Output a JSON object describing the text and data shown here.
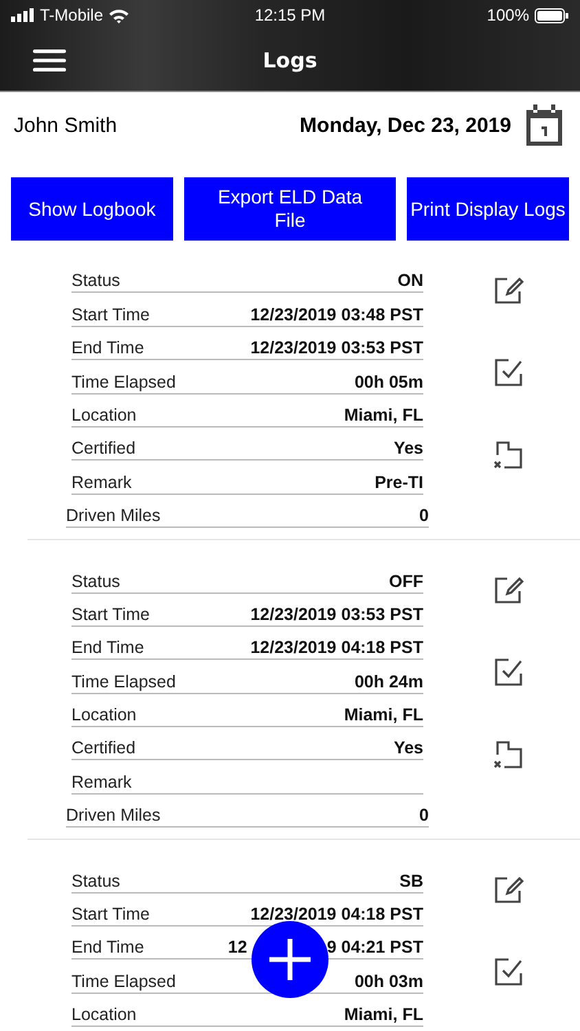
{
  "status_bar": {
    "carrier": "T-Mobile",
    "time": "12:15 PM",
    "battery": "100%"
  },
  "nav": {
    "title": "Logs"
  },
  "header": {
    "driver": "John Smith",
    "date": "Monday, Dec 23, 2019"
  },
  "buttons": [
    {
      "label": "Show Logbook"
    },
    {
      "label": "Export ELD Data File"
    },
    {
      "label": "Print Display Logs"
    }
  ],
  "logs": [
    {
      "rows": [
        {
          "label": "Status",
          "value": "ON"
        },
        {
          "label": "Start Time",
          "value": "12/23/2019 03:48 PST"
        },
        {
          "label": "End Time",
          "value": "12/23/2019 03:53 PST"
        },
        {
          "label": "Time Elapsed",
          "value": "00h 05m"
        },
        {
          "label": "Location",
          "value": "Miami, FL"
        },
        {
          "label": "Certified",
          "value": "Yes"
        },
        {
          "label": "Remark",
          "value": "Pre-TI"
        },
        {
          "label": "Driven Miles",
          "value": "0"
        }
      ],
      "actions": [
        {
          "kind": "edit"
        },
        {
          "kind": "certify"
        },
        {
          "kind": "unassign"
        }
      ]
    },
    {
      "rows": [
        {
          "label": "Status",
          "value": "OFF"
        },
        {
          "label": "Start Time",
          "value": "12/23/2019 03:53 PST"
        },
        {
          "label": "End Time",
          "value": "12/23/2019 04:18 PST"
        },
        {
          "label": "Time Elapsed",
          "value": "00h 24m"
        },
        {
          "label": "Location",
          "value": "Miami, FL"
        },
        {
          "label": "Certified",
          "value": "Yes"
        },
        {
          "label": "Remark"
        },
        {
          "label": "Driven Miles",
          "value": "0"
        }
      ],
      "actions": [
        {
          "kind": "edit"
        },
        {
          "kind": "certify"
        },
        {
          "kind": "unassign"
        }
      ]
    },
    {
      "rows": [
        {
          "label": "Status",
          "value": "SB"
        },
        {
          "label": "Start Time",
          "value": "12/23/2019 04:18 PST"
        },
        {
          "label": "End Time",
          "value_start": "12",
          "value": "9 04:21 PST"
        },
        {
          "label": "Time Elapsed",
          "value": "00h 03m"
        },
        {
          "label": "Location",
          "value": "Miami, FL"
        }
      ],
      "actions": [
        {
          "kind": "edit"
        },
        {
          "kind": "certify"
        }
      ]
    }
  ]
}
